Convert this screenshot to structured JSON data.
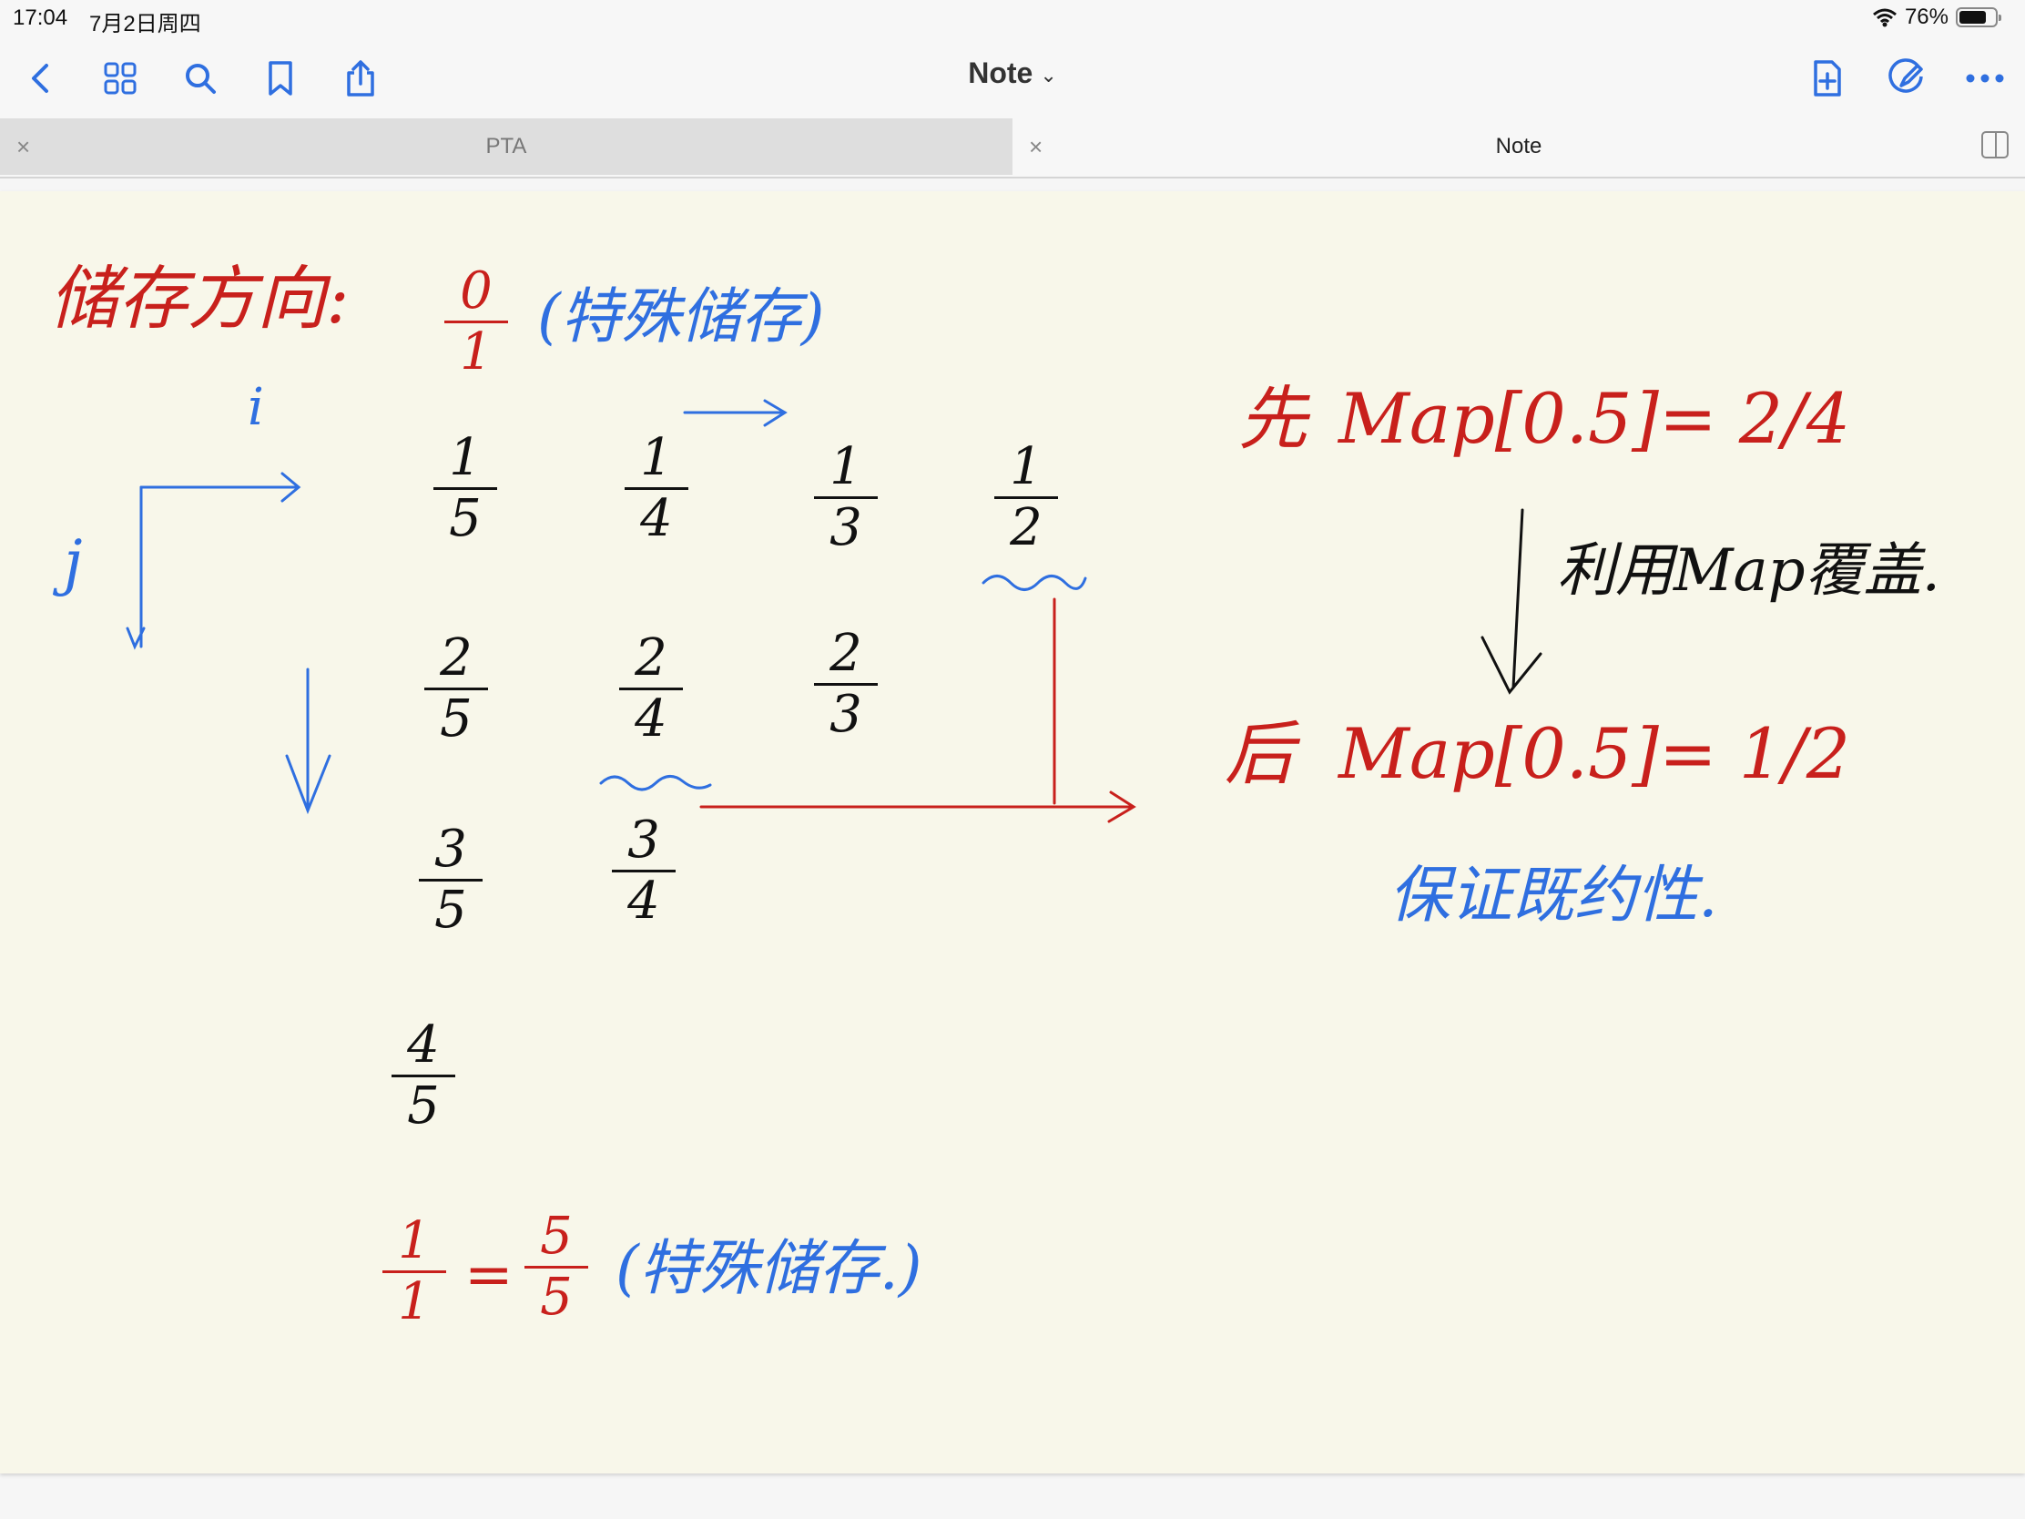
{
  "status": {
    "time": "17:04",
    "date": "7月2日周四",
    "battery": "76%",
    "battery_level": 0.76
  },
  "toolbar": {
    "title": "Note",
    "icons": [
      "back-icon",
      "grid-icon",
      "search-icon",
      "bookmark-icon",
      "share-icon",
      "add-page-icon",
      "pen-icon",
      "more-icon"
    ]
  },
  "tabs": [
    {
      "label": "PTA",
      "active": false
    },
    {
      "label": "Note",
      "active": true
    }
  ],
  "note": {
    "heading": "储存方向:",
    "zero": {
      "num": "0",
      "den": "1"
    },
    "special1": "(特殊储存)",
    "axis_i": "i",
    "axis_j": "j",
    "col1": [
      {
        "num": "1",
        "den": "5"
      },
      {
        "num": "2",
        "den": "5"
      },
      {
        "num": "3",
        "den": "5"
      },
      {
        "num": "4",
        "den": "5"
      }
    ],
    "col2": [
      {
        "num": "1",
        "den": "4"
      },
      {
        "num": "2",
        "den": "4"
      },
      {
        "num": "3",
        "den": "4"
      }
    ],
    "col3": [
      {
        "num": "1",
        "den": "3"
      },
      {
        "num": "2",
        "den": "3"
      }
    ],
    "col4": [
      {
        "num": "1",
        "den": "2"
      }
    ],
    "before_label": "先",
    "before_expr": "Map[0.5]= 2/4",
    "middle_note": "利用Map覆盖.",
    "after_label": "后",
    "after_expr": "Map[0.5]= 1/2",
    "guarantee": "保证既约性.",
    "one_eq": {
      "lhs_num": "1",
      "lhs_den": "1",
      "eq": "=",
      "rhs_num": "5",
      "rhs_den": "5"
    },
    "special2": "(特殊储存.)"
  }
}
